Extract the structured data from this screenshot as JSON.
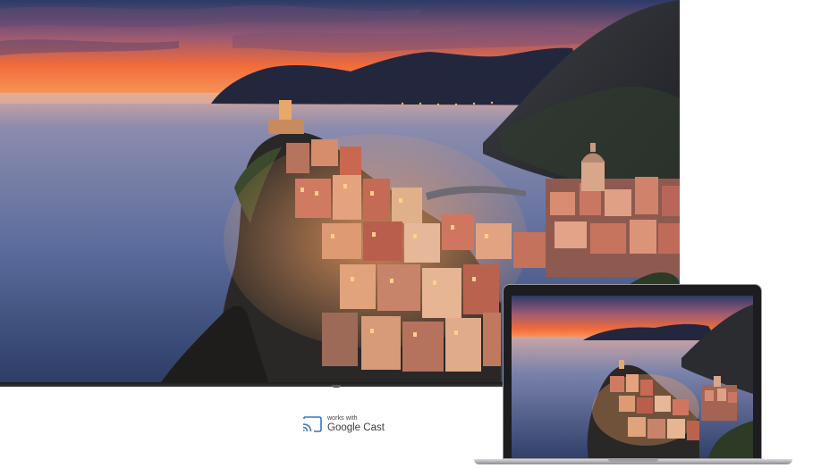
{
  "badge": {
    "small_text": "works with",
    "large_text": "Google Cast",
    "icon": "cast-icon",
    "accent": "#3c75b9"
  },
  "scene": {
    "subject": "sunset-coastal-village",
    "sky_top": "#2d3a63",
    "sky_glow": "#f26b3a",
    "sea": "#5f6f9c",
    "mountain": "#22253a",
    "town_warm": "#d77b5e"
  }
}
